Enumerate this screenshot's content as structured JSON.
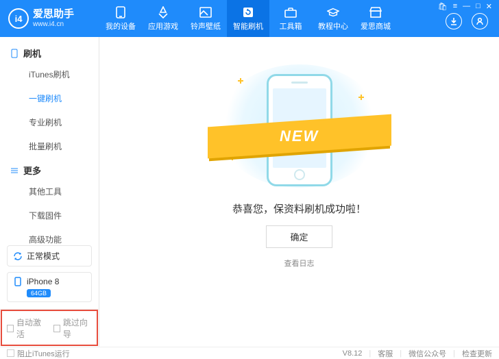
{
  "brand": {
    "short": "i4",
    "title": "爱思助手",
    "url": "www.i4.cn"
  },
  "nav": [
    {
      "label": "我的设备"
    },
    {
      "label": "应用游戏"
    },
    {
      "label": "铃声壁纸"
    },
    {
      "label": "智能刷机"
    },
    {
      "label": "工具箱"
    },
    {
      "label": "教程中心"
    },
    {
      "label": "爱思商城"
    }
  ],
  "nav_active_index": 3,
  "sidebar": {
    "groups": [
      {
        "title": "刷机",
        "items": [
          "iTunes刷机",
          "一键刷机",
          "专业刷机",
          "批量刷机"
        ],
        "active": 1
      },
      {
        "title": "更多",
        "items": [
          "其他工具",
          "下载固件",
          "高级功能"
        ],
        "active": -1
      }
    ],
    "mode": "正常模式",
    "device": {
      "name": "iPhone 8",
      "storage": "64GB"
    },
    "checks": {
      "auto_activate": "自动激活",
      "skip_guide": "跳过向导"
    }
  },
  "main": {
    "ribbon": "NEW",
    "success": "恭喜您，保资料刷机成功啦！",
    "ok": "确定",
    "view_log": "查看日志"
  },
  "footer": {
    "block_itunes": "阻止iTunes运行",
    "version": "V8.12",
    "links": [
      "客服",
      "微信公众号",
      "检查更新"
    ]
  }
}
